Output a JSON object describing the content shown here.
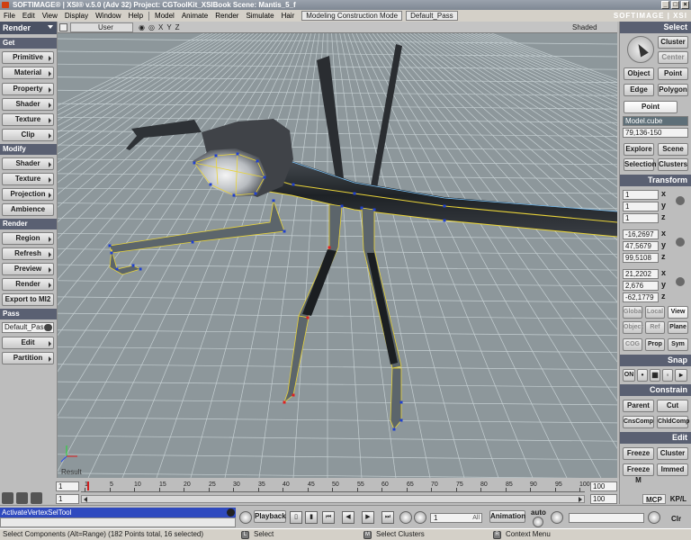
{
  "window": {
    "title": "SOFTIMAGE® | XSI® v.5.0 (Adv 32) Project: CGToolKit_XSIBook    Scene: Mantis_5_f",
    "brand": "SOFTIMAGE | XSI"
  },
  "menubar": {
    "items": [
      "File",
      "Edit",
      "View",
      "Display",
      "Window",
      "Help",
      "Model",
      "Animate",
      "Render",
      "Simulate",
      "Hair"
    ],
    "mode_dropdown": "Modeling Construction Mode",
    "pass_dropdown": "Default_Pass"
  },
  "left_panel": {
    "module": "Render",
    "get_header": "Get",
    "get_items": [
      "Primitive",
      "Material",
      "Property",
      "Shader",
      "Texture",
      "Clip"
    ],
    "modify_header": "Modify",
    "modify_items": [
      "Shader",
      "Texture",
      "Projection",
      "Ambience"
    ],
    "render_header": "Render",
    "render_items": [
      "Region",
      "Refresh",
      "Preview",
      "Render",
      "Export to MI2"
    ],
    "pass_header": "Pass",
    "pass_value": "Default_Pas",
    "pass_items": [
      "Edit",
      "Partition"
    ]
  },
  "viewport": {
    "camera": "User",
    "shading": "Shaded",
    "view_icons": [
      "X",
      "Y",
      "Z"
    ],
    "result_label": "Result",
    "mesh_wire_color": "#e8d33a",
    "vertex_color": "#2040d0",
    "selected_vertex_color": "#e02020",
    "grid_color": "#c5cfd2"
  },
  "right_panel": {
    "select_header": "Select",
    "select_buttons": [
      "Cluster",
      "Center",
      "Object",
      "Point",
      "Edge",
      "Polygon"
    ],
    "active_component": "Point",
    "selection_name": "Model.cube",
    "selection_range": "79,136-150",
    "nav_buttons": [
      "Explore",
      "Scene",
      "Selection",
      "Clusters"
    ],
    "transform_header": "Transform",
    "scale": [
      "1",
      "1",
      "1"
    ],
    "rotation": [
      "-16,2697",
      "47,5679",
      "99,5108"
    ],
    "translation": [
      "21,2202",
      "2,676",
      "-62,1779"
    ],
    "axis_labels": [
      "x",
      "y",
      "z"
    ],
    "ref_buttons": [
      "Global",
      "Local",
      "View",
      "Object",
      "Ref",
      "Plane"
    ],
    "prop_buttons": [
      "COG",
      "Prop",
      "Sym"
    ],
    "snap_header": "Snap",
    "snap_on": "ON",
    "constrain_header": "Constrain",
    "constrain_buttons": [
      "Parent",
      "Cut",
      "CnsComp",
      "ChldComp"
    ],
    "edit_header": "Edit",
    "edit_buttons": [
      "Freeze",
      "Cluster",
      "Freeze M",
      "Immed"
    ]
  },
  "timeline": {
    "start_frame": "1",
    "current_frame": "1",
    "end_frame": "100",
    "end_frame_2": "100",
    "ticks": [
      "1",
      "5",
      "10",
      "15",
      "20",
      "25",
      "30",
      "35",
      "40",
      "45",
      "50",
      "55",
      "60",
      "65",
      "70",
      "75",
      "80",
      "85",
      "90",
      "95",
      "100"
    ],
    "tabs": [
      "MCP",
      "KP/L"
    ]
  },
  "playback": {
    "label": "Playback",
    "frame": "1",
    "frame_suffix": "All",
    "animation_label": "Animation",
    "auto_label": "auto",
    "clr_label": "Clr"
  },
  "command": {
    "current_command": "ActivateVertexSelTool"
  },
  "status": {
    "message": "Select Components (Alt=Range) (182 Points total, 16 selected)",
    "left_mouse": "Select",
    "middle_mouse": "Select Clusters",
    "right_mouse": "Context Menu",
    "left_key": "L",
    "middle_key": "M",
    "right_key": "R"
  }
}
